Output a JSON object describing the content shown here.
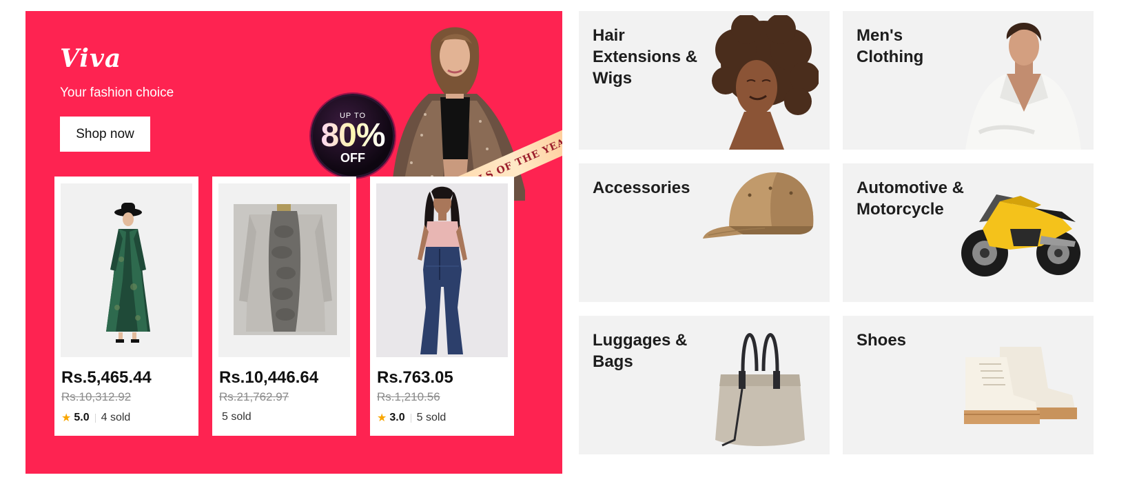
{
  "promo": {
    "brand": "Viva",
    "tagline": "Your fashion choice",
    "shop_button": "Shop now",
    "badge": {
      "up_to": "UP TO",
      "percent": "80%",
      "off": "OFF"
    },
    "ribbon": "DEALS OF THE YEAR",
    "background_color": "#fe2351",
    "products": [
      {
        "price": "Rs.5,465.44",
        "original_price": "Rs.10,312.92",
        "rating": "5.0",
        "sold": "4 sold"
      },
      {
        "price": "Rs.10,446.64",
        "original_price": "Rs.21,762.97",
        "rating": "",
        "sold": "5 sold"
      },
      {
        "price": "Rs.763.05",
        "original_price": "Rs.1,210.56",
        "rating": "3.0",
        "sold": "5 sold"
      }
    ]
  },
  "categories": [
    {
      "title": "Hair Extensions & Wigs",
      "icon": "woman-curly-hair-photo"
    },
    {
      "title": "Men's Clothing",
      "icon": "man-white-shirt-photo"
    },
    {
      "title": "Accessories",
      "icon": "cap-icon"
    },
    {
      "title": "Automotive & Motorcycle",
      "icon": "motorcycle-icon"
    },
    {
      "title": "Luggages & Bags",
      "icon": "tote-bag-icon"
    },
    {
      "title": "Shoes",
      "icon": "sneaker-icon"
    }
  ]
}
